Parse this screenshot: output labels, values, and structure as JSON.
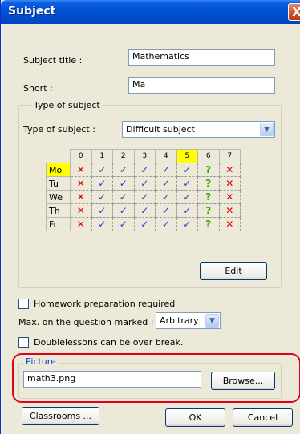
{
  "window": {
    "title": "Subject",
    "close_glyph": "X"
  },
  "subject_title": {
    "label": "Subject title :",
    "value": "Mathematics"
  },
  "short": {
    "label": "Short :",
    "value": "Ma"
  },
  "type_group": {
    "legend": "Type of subject",
    "label": "Type of subject :",
    "selected": "Difficult subject"
  },
  "timetable": {
    "periods": [
      "0",
      "1",
      "2",
      "3",
      "4",
      "5",
      "6",
      "7"
    ],
    "highlight_period": "5",
    "days": [
      {
        "name": "Mo",
        "highlighted": true,
        "cells": [
          "x",
          "v",
          "v",
          "v",
          "v",
          "v",
          "?",
          "x"
        ]
      },
      {
        "name": "Tu",
        "highlighted": false,
        "cells": [
          "x",
          "v",
          "v",
          "v",
          "v",
          "v",
          "?",
          "x"
        ]
      },
      {
        "name": "We",
        "highlighted": false,
        "cells": [
          "x",
          "v",
          "v",
          "v",
          "v",
          "v",
          "?",
          "x"
        ]
      },
      {
        "name": "Th",
        "highlighted": false,
        "cells": [
          "x",
          "v",
          "v",
          "v",
          "v",
          "v",
          "?",
          "x"
        ]
      },
      {
        "name": "Fr",
        "highlighted": false,
        "cells": [
          "x",
          "v",
          "v",
          "v",
          "v",
          "v",
          "?",
          "x"
        ]
      }
    ],
    "symbols": {
      "x": "✕",
      "v": "✓",
      "?": "?"
    },
    "colors": {
      "x": "#e00000",
      "v": "#1a3fd6",
      "?": "#2eaa00",
      "highlight": "#ffff00"
    }
  },
  "edit_button": "Edit",
  "homework": {
    "label": "Homework preparation required",
    "checked": false
  },
  "max_question": {
    "label": "Max. on the question marked :",
    "selected": "Arbitrary"
  },
  "doublelessons": {
    "label": "Doublelessons can be over break.",
    "checked": false
  },
  "picture_group": {
    "legend": "Picture",
    "value": "math3.png",
    "browse_label": "Browse..."
  },
  "buttons": {
    "classrooms": "Classrooms ...",
    "ok": "OK",
    "cancel": "Cancel"
  },
  "accent_colors": {
    "highlight_border": "#e0001a",
    "titlebar": "#0150d2"
  }
}
